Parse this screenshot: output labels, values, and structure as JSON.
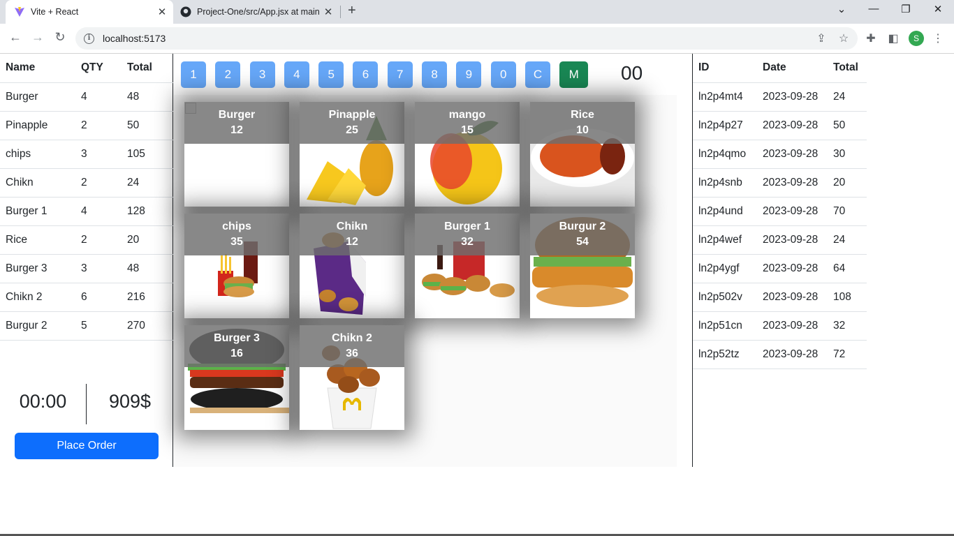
{
  "browser": {
    "tabs": [
      {
        "title": "Vite + React",
        "active": true
      },
      {
        "title": "Project-One/src/App.jsx at main",
        "active": false
      }
    ],
    "url": "localhost:5173",
    "profile_initial": "S"
  },
  "order": {
    "headers": [
      "Name",
      "QTY",
      "Total"
    ],
    "rows": [
      [
        "Burger",
        "4",
        "48"
      ],
      [
        "Pinapple",
        "2",
        "50"
      ],
      [
        "chips",
        "3",
        "105"
      ],
      [
        "Chikn",
        "2",
        "24"
      ],
      [
        "Burger 1",
        "4",
        "128"
      ],
      [
        "Rice",
        "2",
        "20"
      ],
      [
        "Burger 3",
        "3",
        "48"
      ],
      [
        "Chikn 2",
        "6",
        "216"
      ],
      [
        "Burgur 2",
        "5",
        "270"
      ]
    ],
    "time": "00:00",
    "grand_total": "909$",
    "place_order_label": "Place Order"
  },
  "keypad": {
    "keys": [
      "1",
      "2",
      "3",
      "4",
      "5",
      "6",
      "7",
      "8",
      "9",
      "0",
      "C",
      "M"
    ],
    "display": "00"
  },
  "products": [
    {
      "name": "Burger",
      "price": "12",
      "image": "broken"
    },
    {
      "name": "Pinapple",
      "price": "25",
      "image": "pineapple"
    },
    {
      "name": "mango",
      "price": "15",
      "image": "mango"
    },
    {
      "name": "Rice",
      "price": "10",
      "image": "rice-plate"
    },
    {
      "name": "chips",
      "price": "35",
      "image": "fries-meal"
    },
    {
      "name": "Chikn",
      "price": "12",
      "image": "nuggets-box"
    },
    {
      "name": "Burger 1",
      "price": "32",
      "image": "burger-combo"
    },
    {
      "name": "Burgur 2",
      "price": "54",
      "image": "chicken-burger"
    },
    {
      "name": "Burger 3",
      "price": "16",
      "image": "black-burger"
    },
    {
      "name": "Chikn 2",
      "price": "36",
      "image": "chicken-bucket"
    }
  ],
  "history": {
    "headers": [
      "ID",
      "Date",
      "Total"
    ],
    "rows": [
      [
        "ln2p4mt4",
        "2023-09-28",
        "24"
      ],
      [
        "ln2p4p27",
        "2023-09-28",
        "50"
      ],
      [
        "ln2p4qmo",
        "2023-09-28",
        "30"
      ],
      [
        "ln2p4snb",
        "2023-09-28",
        "20"
      ],
      [
        "ln2p4und",
        "2023-09-28",
        "70"
      ],
      [
        "ln2p4wef",
        "2023-09-28",
        "24"
      ],
      [
        "ln2p4ygf",
        "2023-09-28",
        "64"
      ],
      [
        "ln2p502v",
        "2023-09-28",
        "108"
      ],
      [
        "ln2p51cn",
        "2023-09-28",
        "32"
      ],
      [
        "ln2p52tz",
        "2023-09-28",
        "72"
      ]
    ]
  }
}
